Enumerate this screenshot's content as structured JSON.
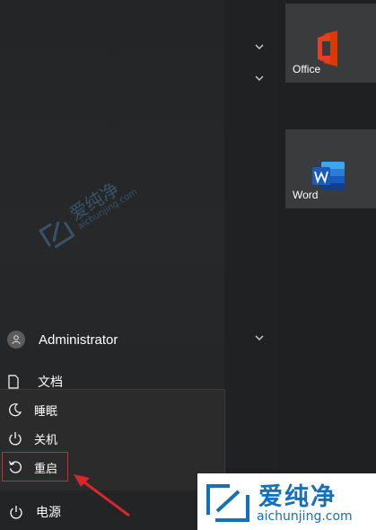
{
  "start_menu": {
    "user": {
      "name": "Administrator"
    },
    "documents_label": "文档",
    "power_menu": {
      "items": [
        {
          "label": "睡眠",
          "icon": "sleep-icon"
        },
        {
          "label": "关机",
          "icon": "power-icon"
        },
        {
          "label": "重启",
          "icon": "restart-icon"
        }
      ]
    },
    "power_label": "电源"
  },
  "tiles": [
    {
      "label": "Office",
      "icon": "office-icon"
    },
    {
      "label": "Word",
      "icon": "word-icon"
    }
  ],
  "watermark": {
    "title": "爱纯净",
    "url": "aichunjing.com",
    "faint_title": "爱纯净",
    "faint_url": "aichunjing.com"
  },
  "colors": {
    "accent_blue": "#1670b8",
    "highlight_red": "#d8262b",
    "office_red": "#d83b01",
    "word_blue": "#185abd"
  }
}
